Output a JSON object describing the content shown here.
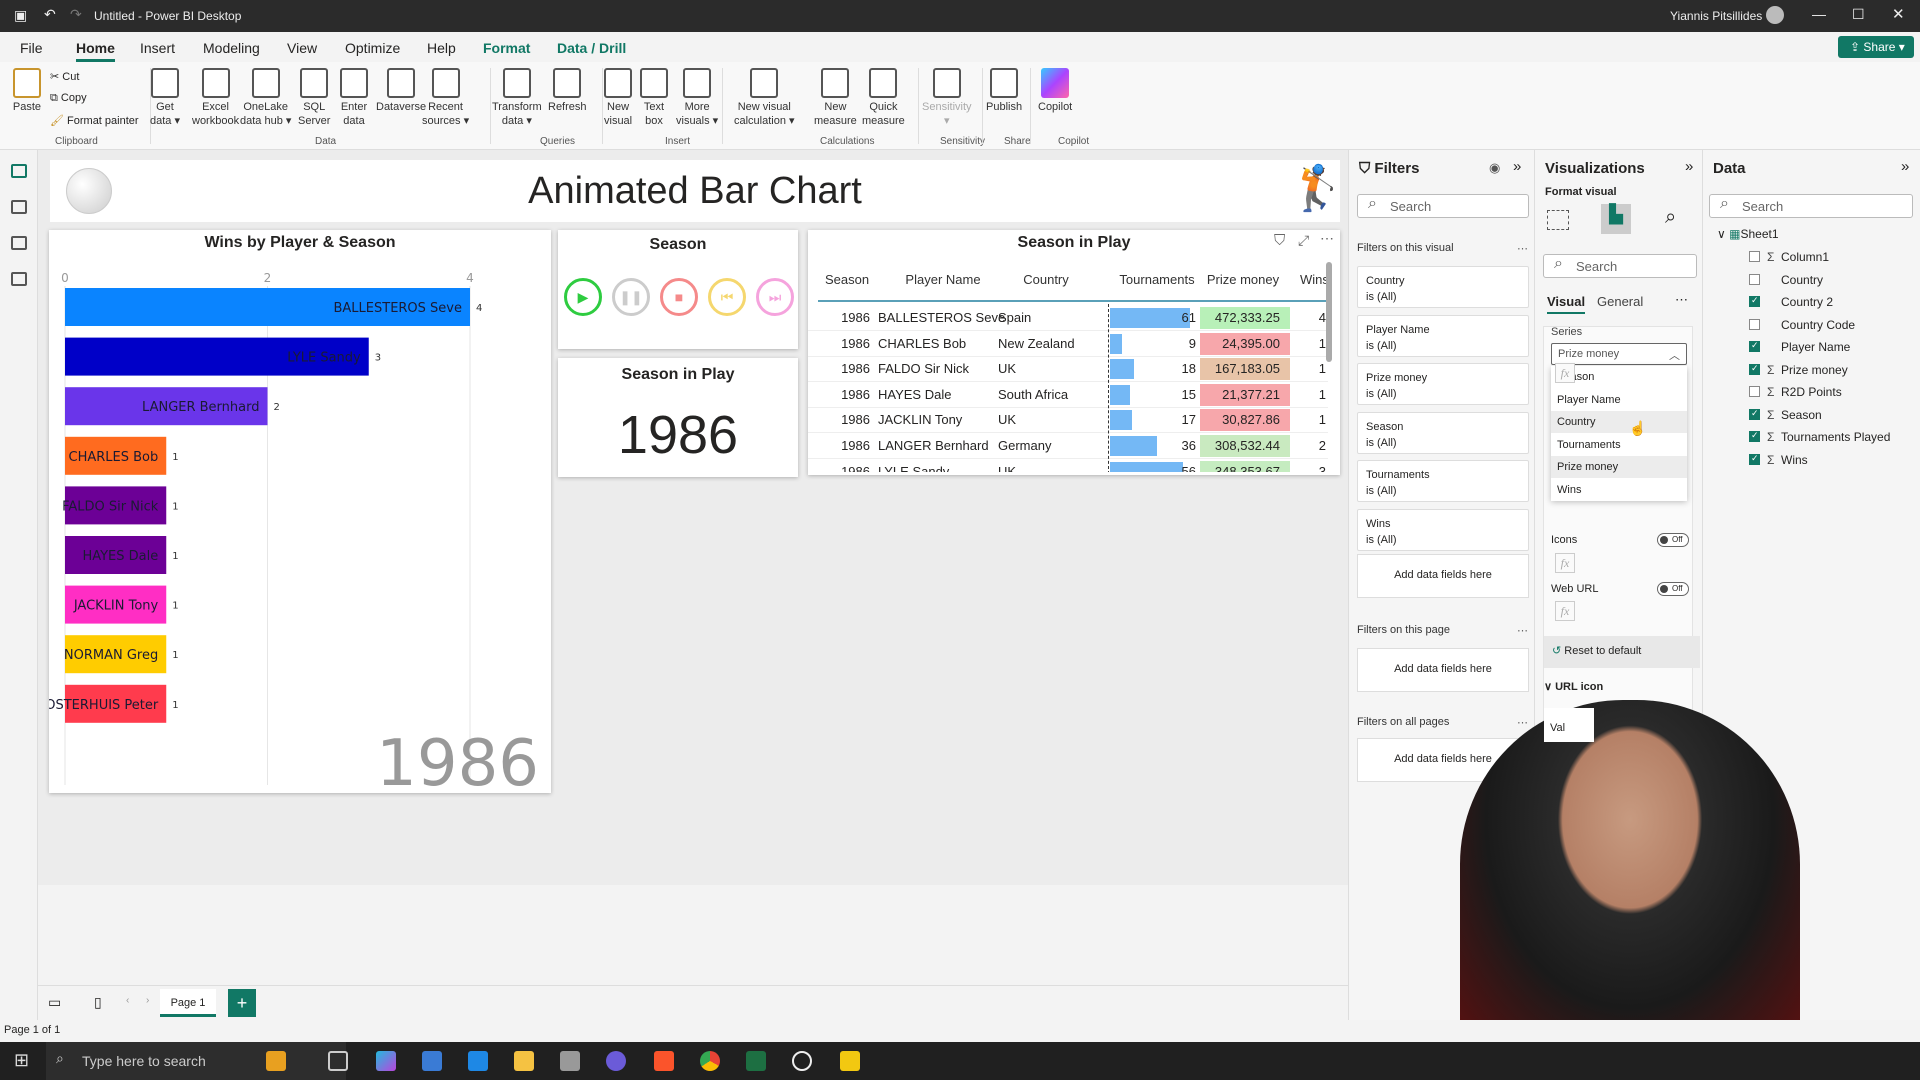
{
  "window": {
    "title": "Untitled - Power BI Desktop",
    "user": "Yiannis Pitsillides",
    "share": "Share"
  },
  "menu": [
    "File",
    "Home",
    "Insert",
    "Modeling",
    "View",
    "Optimize",
    "Help",
    "Format",
    "Data / Drill"
  ],
  "ribbon": {
    "clipboard": {
      "paste": "Paste",
      "cut": "Cut",
      "copy": "Copy",
      "format_painter": "Format painter",
      "group": "Clipboard"
    },
    "buttons": [
      {
        "label": "Get\ndata ▾"
      },
      {
        "label": "Excel\nworkbook"
      },
      {
        "label": "OneLake\ndata hub ▾"
      },
      {
        "label": "SQL\nServer"
      },
      {
        "label": "Enter\ndata"
      },
      {
        "label": "Dataverse"
      },
      {
        "label": "Recent\nsources ▾"
      },
      {
        "label": "Transform\ndata ▾"
      },
      {
        "label": "Refresh"
      },
      {
        "label": "New\nvisual"
      },
      {
        "label": "Text\nbox"
      },
      {
        "label": "More\nvisuals ▾"
      },
      {
        "label": "New visual\ncalculation ▾"
      },
      {
        "label": "New\nmeasure"
      },
      {
        "label": "Quick\nmeasure"
      },
      {
        "label": "Sensitivity\n▾"
      },
      {
        "label": "Publish"
      },
      {
        "label": "Copilot"
      }
    ],
    "groups": [
      "Data",
      "Queries",
      "Insert",
      "Calculations",
      "Sensitivity",
      "Share",
      "Copilot"
    ]
  },
  "report": {
    "title": "Animated Bar Chart"
  },
  "chart_data": {
    "type": "bar",
    "title": "Wins by Player & Season",
    "xlim": [
      0,
      4
    ],
    "xticks": [
      "0",
      "2",
      "4"
    ],
    "categories": [
      "BALLESTEROS Seve",
      "LYLE Sandy",
      "LANGER Bernhard",
      "CHARLES Bob",
      "FALDO Sir Nick",
      "HAYES Dale",
      "JACKLIN Tony",
      "NORMAN Greg",
      "OOSTERHUIS Peter"
    ],
    "values": [
      4,
      3,
      2,
      1,
      1,
      1,
      1,
      1,
      1
    ],
    "colors": [
      "#0a84ff",
      "#0000c8",
      "#6a35ea",
      "#ff6b1f",
      "#6c0096",
      "#6c0096",
      "#ff2ec4",
      "#ffcc00",
      "#ff3b4d"
    ],
    "annotation": "1986",
    "grid": true
  },
  "season_slicer": {
    "title": "Season",
    "controls": [
      "play",
      "pause",
      "stop",
      "previous",
      "next"
    ],
    "colors": {
      "play": "#2ecc40",
      "pause": "#cccccc",
      "stop": "#f58a8a",
      "previous": "#f5d76e",
      "next": "#f5a3dd"
    }
  },
  "card": {
    "title": "Season in Play",
    "value": "1986"
  },
  "table": {
    "title": "Season in Play",
    "columns": [
      "Season",
      "Player Name",
      "Country",
      "Tournaments",
      "Prize money",
      "Wins"
    ],
    "rows": [
      [
        "1986",
        "BALLESTEROS Seve",
        "Spain",
        "61",
        "472,333.25",
        "4"
      ],
      [
        "1986",
        "CHARLES Bob",
        "New Zealand",
        "9",
        "24,395.00",
        "1"
      ],
      [
        "1986",
        "FALDO Sir Nick",
        "UK",
        "18",
        "167,183.05",
        "1"
      ],
      [
        "1986",
        "HAYES Dale",
        "South Africa",
        "15",
        "21,377.21",
        "1"
      ],
      [
        "1986",
        "JACKLIN Tony",
        "UK",
        "17",
        "30,827.86",
        "1"
      ],
      [
        "1986",
        "LANGER Bernhard",
        "Germany",
        "36",
        "308,532.44",
        "2"
      ],
      [
        "1986",
        "LYLE Sandy",
        "UK",
        "56",
        "348,353.67",
        "3"
      ]
    ],
    "prize_colors": [
      "#b8f0b8",
      "#f7a7ab",
      "#e8c4a8",
      "#f7a7ab",
      "#f7a7ab",
      "#c9eac0",
      "#c5ecc0"
    ]
  },
  "filters": {
    "title": "Filters",
    "search": "Search",
    "on_visual": "Filters on this visual",
    "cards": [
      {
        "name": "Country",
        "state": "is (All)"
      },
      {
        "name": "Player Name",
        "state": "is (All)"
      },
      {
        "name": "Prize money",
        "state": "is (All)"
      },
      {
        "name": "Season",
        "state": "is (All)"
      },
      {
        "name": "Tournaments",
        "state": "is (All)"
      },
      {
        "name": "Wins",
        "state": "is (All)"
      }
    ],
    "add": "Add data fields here",
    "on_page": "Filters on this page",
    "on_all": "Filters on all pages"
  },
  "viz": {
    "title": "Visualizations",
    "format_visual": "Format visual",
    "search": "Search",
    "tab_visual": "Visual",
    "tab_general": "General",
    "series_label": "Series",
    "series_value": "Prize money",
    "options": [
      "Season",
      "Player Name",
      "Country",
      "Tournaments",
      "Prize money",
      "Wins"
    ],
    "icons_label": "Icons",
    "web_url_label": "Web URL",
    "toggle_off": "Off",
    "fx": "fx",
    "reset": "Reset to default",
    "url_icon": "URL icon",
    "value_partial": "Val"
  },
  "data": {
    "title": "Data",
    "search": "Search",
    "table": "Sheet1",
    "fields": [
      {
        "name": "Column1",
        "sigma": true,
        "checked": false
      },
      {
        "name": "Country",
        "sigma": false,
        "checked": false
      },
      {
        "name": "Country 2",
        "sigma": false,
        "checked": true
      },
      {
        "name": "Country Code",
        "sigma": false,
        "checked": false
      },
      {
        "name": "Player Name",
        "sigma": false,
        "checked": true
      },
      {
        "name": "Prize money",
        "sigma": true,
        "checked": true
      },
      {
        "name": "R2D Points",
        "sigma": true,
        "checked": false
      },
      {
        "name": "Season",
        "sigma": true,
        "checked": true
      },
      {
        "name": "Tournaments Played",
        "sigma": true,
        "checked": true
      },
      {
        "name": "Wins",
        "sigma": true,
        "checked": true
      }
    ]
  },
  "pages": {
    "current": "Page 1",
    "add": "+"
  },
  "status": "Page 1 of 1",
  "taskbar": {
    "search": "Type here to search"
  }
}
